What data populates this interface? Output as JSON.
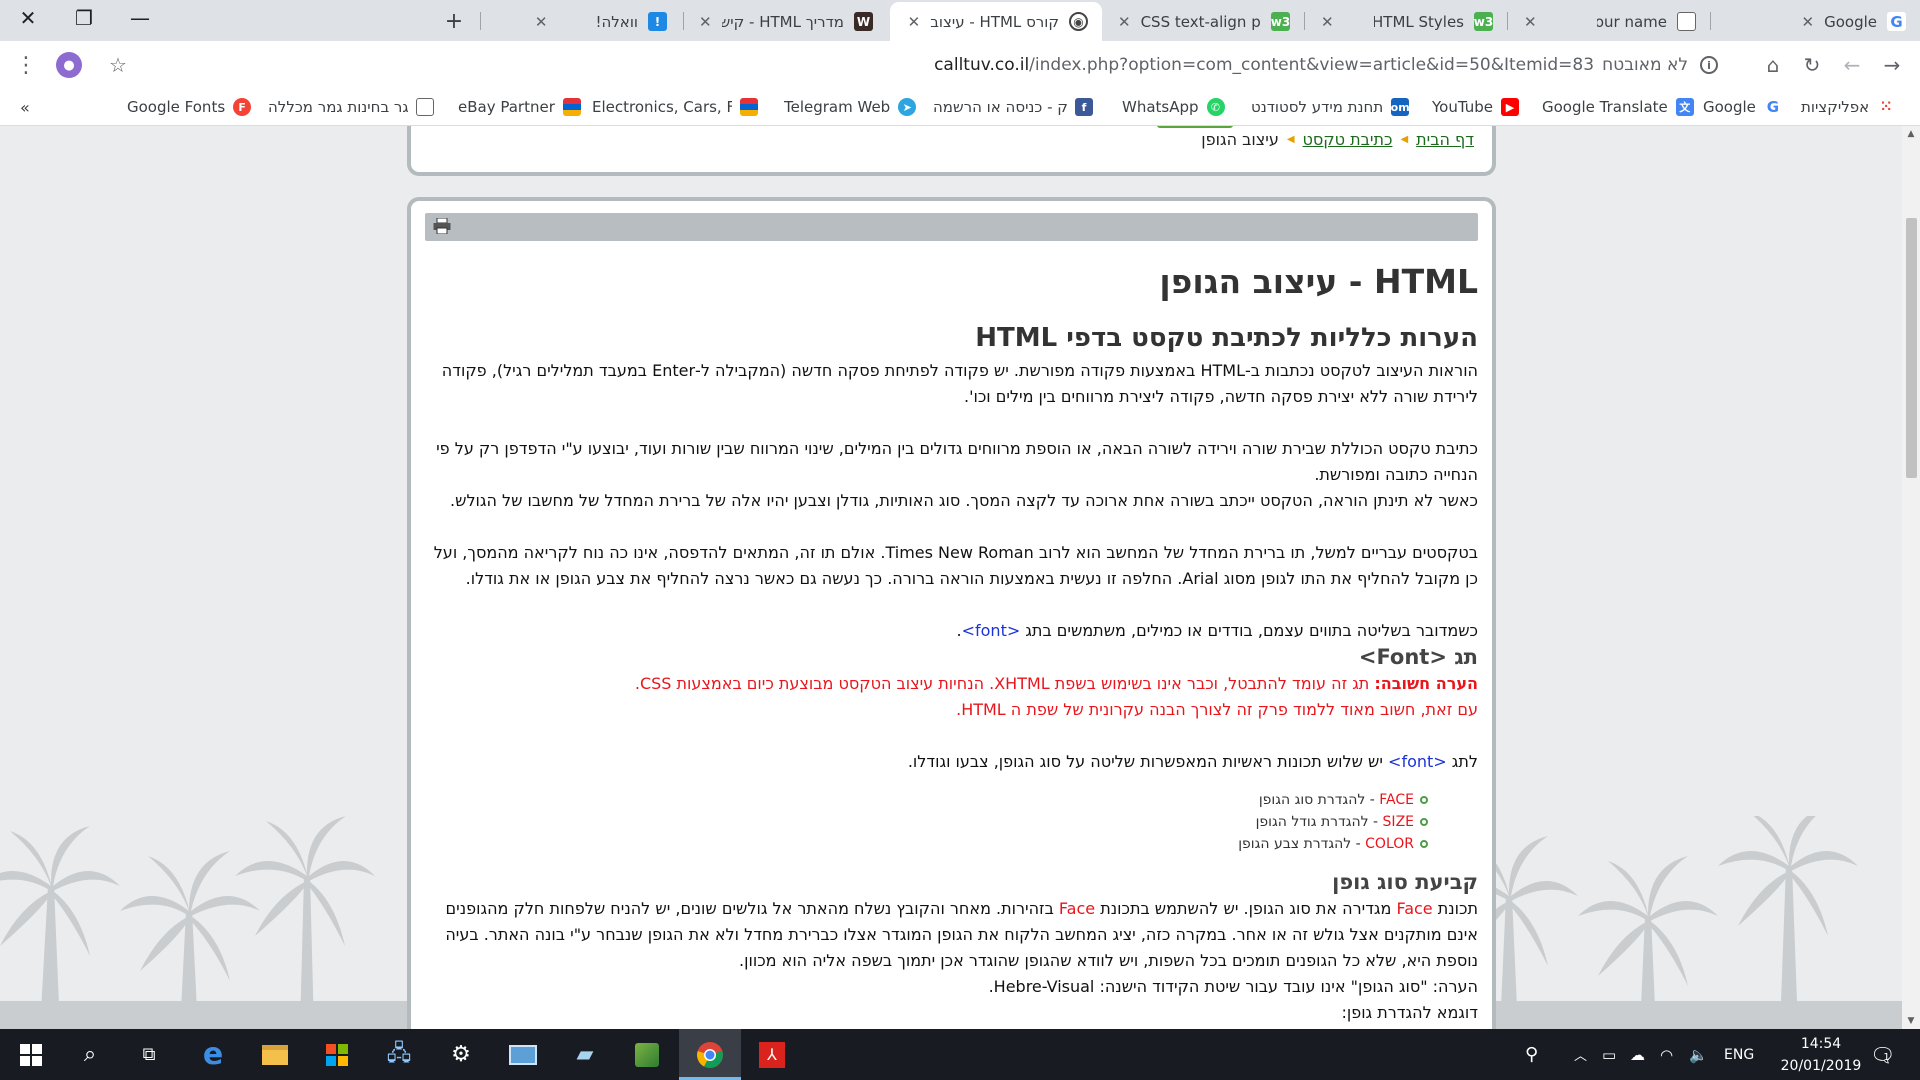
{
  "browser": {
    "tabs": [
      {
        "title": "Google",
        "favicon": "google-g",
        "active": false
      },
      {
        "title": "Your name",
        "favicon": "document",
        "active": false
      },
      {
        "title": "HTML Styles",
        "favicon": "w3-green",
        "active": false
      },
      {
        "title": "CSS text-align property",
        "favicon": "w3-green",
        "active": false
      },
      {
        "title": "קורס HTML - עיצוב",
        "favicon": "site-owl",
        "active": true
      },
      {
        "title": "מדריך HTML - קיש",
        "favicon": "w-logo",
        "active": false
      },
      {
        "title": "וואלה!",
        "favicon": "walla",
        "active": false
      }
    ],
    "url_domain": "calltuv.co.il",
    "url_path": "/index.php?option=com_content&view=article&id=50&Itemid=83",
    "security_label": "לא מאובטח",
    "avatar_initial": "●",
    "bookmarks": [
      {
        "label": "אפליקציות",
        "icon": "apps-grid"
      },
      {
        "label": "Google",
        "icon": "google-g"
      },
      {
        "label": "Google Translate",
        "icon": "translate"
      },
      {
        "label": "YouTube",
        "icon": "youtube"
      },
      {
        "label": "תחנת מידע לסטודנט",
        "icon": "om"
      },
      {
        "label": "WhatsApp",
        "icon": "whatsapp"
      },
      {
        "label": "פייסבוק - כניסה או הרשמה",
        "icon": "facebook"
      },
      {
        "label": "Telegram Web",
        "icon": "telegram"
      },
      {
        "label": "Electronics, Cars, Fashion",
        "icon": "ebay"
      },
      {
        "label": "eBay Partner",
        "icon": "ebay"
      },
      {
        "label": "מאגר בחינות גמר מכללה",
        "icon": "document"
      },
      {
        "label": "Google Fonts",
        "icon": "google-fonts"
      }
    ],
    "bookmarks_overflow": "«"
  },
  "page": {
    "breadcrumb": {
      "home": "דף הבית",
      "section": "כתיבת טקסט",
      "current": "עיצוב הגופן"
    },
    "title": "HTML - עיצוב הגופן",
    "subtitle": "הערות כלליות לכתיבת טקסט בדפי HTML",
    "p1": "הוראות העיצוב לטקסט נכתבות ב-HTML באמצעות פקודה מפורשת. יש פקודה לפתיחת פסקה חדשה (המקבילה ל-Enter במעבד תמלילים רגיל), פקודה לירידת שורה ללא יצירת פסקה חדשה, פקודה ליצירת מרווחים בין מילים וכו'.",
    "p2": "כתיבת טקסט הכוללת שבירת שורה וירידה לשורה הבאה, או הוספת מרווחים גדולים בין המילים, שינוי המרווח שבין שורות ועוד, יבוצעו ע\"י הדפדפן רק על פי הנחייה כתובה ומפורשת.",
    "p3": "כאשר לא תינתן הוראה, הטקסט ייכתב בשורה אחת ארוכה עד לקצה המסך. סוג האותיות, גודלן וצבען יהיו אלה של ברירת המחדל של מחשבו של הגולש.",
    "p4": "בטקסטים עבריים למשל, תו ברירת המחדל של המחשב הוא לרוב Times New Roman. אולם תו זה, המתאים להדפסה, אינו כה נוח לקריאה מהמסך, ועל כן מקובל להחליף את התו לגופן מסוג Arial. החלפה זו נעשית באמצעות הוראה ברורה. כך נעשה גם כאשר נרצה להחליף את צבע הגופן או את גודלו.",
    "p5_before": "כשמדובר בשליטה בתווים עצמם, בודדים או כמילים, משתמשים בתג ",
    "p5_tag": "<font>",
    "p5_after": ".",
    "font_heading": "תג <Font>",
    "note_label": "הערה חשובה:",
    "note_text": " תג זה עומד להתבטל, וכבר אינו בשימוש בשפת XHTML. הנחיות עיצוב הטקסט מבוצעת כיום באמצעות CSS.",
    "note_line2": "עם זאת, חשוב מאוד ללמוד פרק זה לצורך הבנה עקרונית של שפת ה HTML.",
    "p6_before": "לתג ",
    "p6_tag": "<font>",
    "p6_after": " יש שלוש תכונות ראשיות המאפשרות שליטה על סוג הגופן, צבעו וגודלו.",
    "features": [
      {
        "name": "FACE",
        "desc": " - להגדרת סוג הגופן"
      },
      {
        "name": "SIZE",
        "desc": " - להגדרת גודל הגופן"
      },
      {
        "name": "COLOR",
        "desc": " - להגדרת צבע הגופן"
      }
    ],
    "face_heading": "קביעת סוג גופן",
    "p7_a": "תכונת ",
    "p7_face": "Face",
    "p7_b": " מגדירה את סוג הגופן. יש להשתמש בתכונת ",
    "p7_face2": "Face",
    "p7_c": " בזהירות. מאחר והקובץ נשלח מהאתר אל גולשים שונים, יש להניח שלפחות חלק מהגופנים אינם מותקנים אצל גולש זה או אחר. במקרה כזה, יציג המחשב הלקוח את הגופן המוגדר אצלו כברירת מחדל ולא את הגופן שנבחר ע\"י בונה האתר. בעיה נוספת היא, שלא כל הגופנים תומכים בכל השפות, ויש לוודא שהגופן שהוגדר אכן יתמוך בשפה אליה הוא מכוון.",
    "p8": "הערה: \"סוג הגופן\" אינו עובד עבור שיטת הקידוד הישנה: Hebre-Visual.",
    "p9": "דוגמא להגדרת גופן:"
  },
  "taskbar": {
    "apps": [
      "start",
      "search",
      "task-view",
      "edge",
      "file-explorer",
      "store",
      "network-app",
      "settings",
      "outlook-card",
      "notepad",
      "package-app",
      "chrome",
      "acrobat"
    ],
    "active_app": "chrome",
    "language": "ENG",
    "time": "14:54",
    "date": "20/01/2019",
    "notification_count": "1"
  },
  "colors": {
    "link_green": "#1b6a1b",
    "tag_blue": "#1a32d6",
    "note_red": "#e8161c",
    "frame_gray": "#b3bbbe"
  }
}
